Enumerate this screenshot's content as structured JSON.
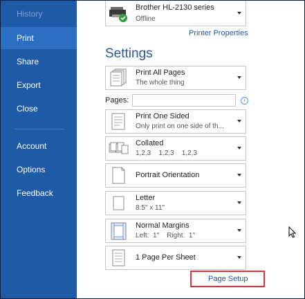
{
  "sidebar": {
    "items": [
      {
        "label": "History"
      },
      {
        "label": "Print"
      },
      {
        "label": "Share"
      },
      {
        "label": "Export"
      },
      {
        "label": "Close"
      },
      {
        "label": "Account"
      },
      {
        "label": "Options"
      },
      {
        "label": "Feedback"
      }
    ],
    "active": "Print",
    "color": "#1f5aa6"
  },
  "printer": {
    "name": "Brother HL-2130 series",
    "status": "Offline",
    "properties_link": "Printer Properties",
    "icon": "printer-icon"
  },
  "settings": {
    "title": "Settings",
    "print_range": {
      "label": "Print All Pages",
      "sub": "The whole thing"
    },
    "pages_label": "Pages:",
    "pages_value": "",
    "sides": {
      "label": "Print One Sided",
      "sub": "Only print on one side of th..."
    },
    "collation": {
      "label": "Collated",
      "sub": "1,2,3    1,2,3    1,2,3"
    },
    "orientation": {
      "label": "Portrait Orientation"
    },
    "paper": {
      "label": "Letter",
      "sub": "8.5\" x 11\""
    },
    "margins": {
      "label": "Normal Margins",
      "sub": "Left:  1\"    Right:  1\""
    },
    "per_sheet": {
      "label": "1 Page Per Sheet"
    },
    "page_setup_link": "Page Setup"
  },
  "colors": {
    "accent": "#2b579a",
    "highlight": "#e0303c"
  }
}
